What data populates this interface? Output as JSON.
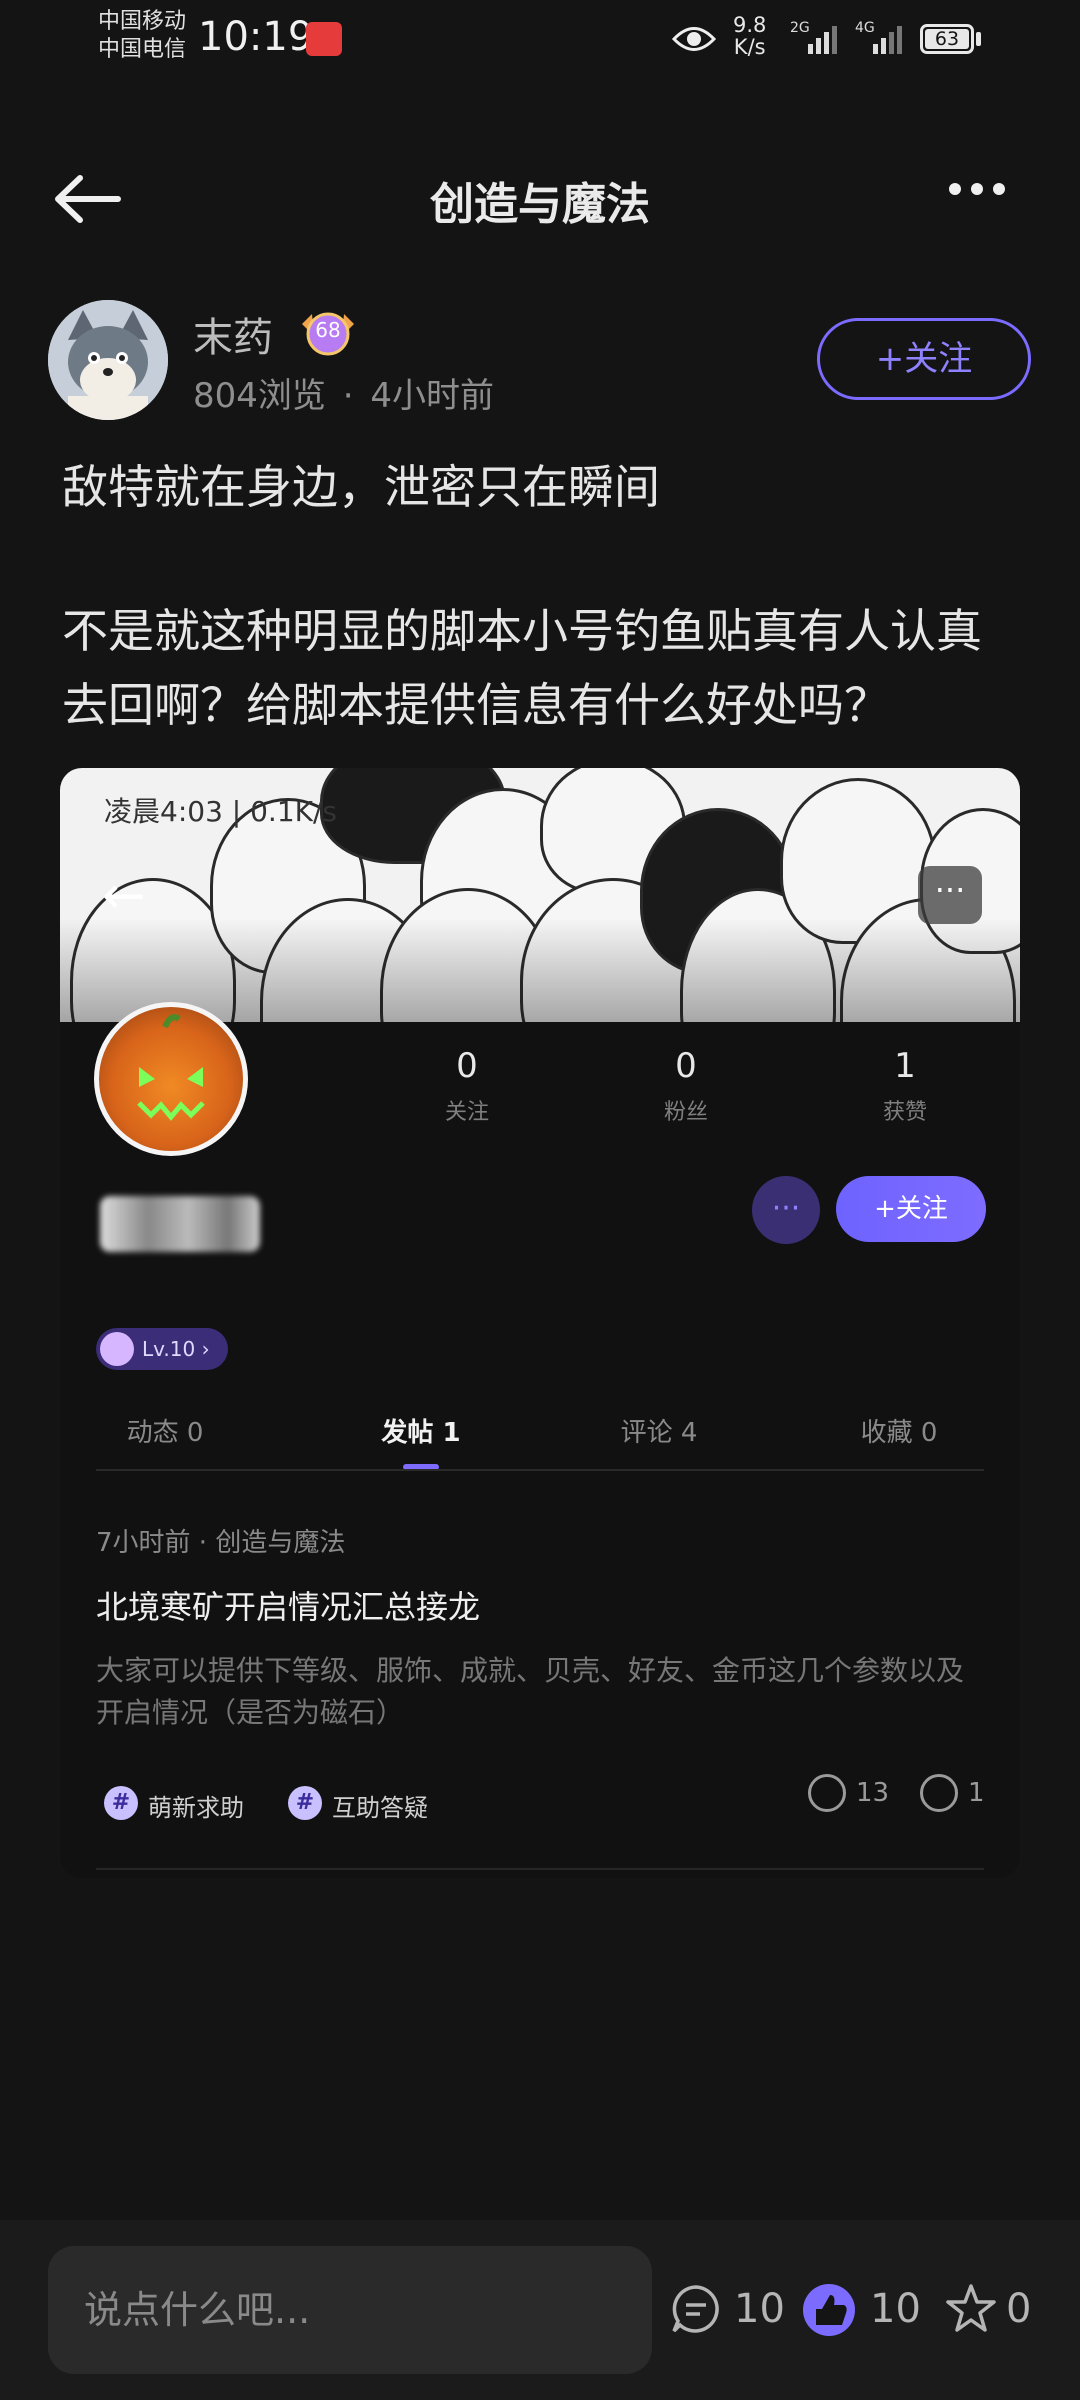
{
  "status_bar": {
    "carrier1": "中国移动",
    "carrier2": "中国电信",
    "time": "10:19",
    "speed_value": "9.8",
    "speed_unit": "K/s",
    "network1": "2G",
    "network2": "4G",
    "battery": "63"
  },
  "header": {
    "title": "创造与魔法"
  },
  "author": {
    "name": "末药",
    "level": "68",
    "views": "804浏览",
    "separator": "·",
    "time": "4小时前",
    "follow_label": "+关注"
  },
  "post": {
    "line1": "敌特就在身边，泄密只在瞬间",
    "line2a": "不是就这种明显的脚本小号钓鱼贴真有人认真",
    "line2b": "去回啊？给脚本提供信息有什么好处吗？"
  },
  "embedded": {
    "status_text": "凌晨4:03 | 0.1K/s",
    "stats": [
      {
        "value": "0",
        "label": "关注"
      },
      {
        "value": "0",
        "label": "粉丝"
      },
      {
        "value": "1",
        "label": "获赞"
      }
    ],
    "follow_label": "+关注",
    "level_label": "Lv.10",
    "tabs": [
      {
        "label": "动态 0"
      },
      {
        "label": "发帖 1"
      },
      {
        "label": "评论 4"
      },
      {
        "label": "收藏 0"
      }
    ],
    "post": {
      "meta": "7小时前 · 创造与魔法",
      "title": "北境寒矿开启情况汇总接龙",
      "desc": "大家可以提供下等级、服饰、成就、贝壳、好友、金币这几个参数以及开启情况（是否为磁石）",
      "tags": [
        "萌新求助",
        "互助答疑"
      ],
      "comments": "13",
      "likes": "1"
    }
  },
  "bottom_bar": {
    "placeholder": "说点什么吧...",
    "comments": "10",
    "likes": "10",
    "favorites": "0"
  },
  "colors": {
    "accent": "#7b6cff",
    "background": "#141414"
  }
}
